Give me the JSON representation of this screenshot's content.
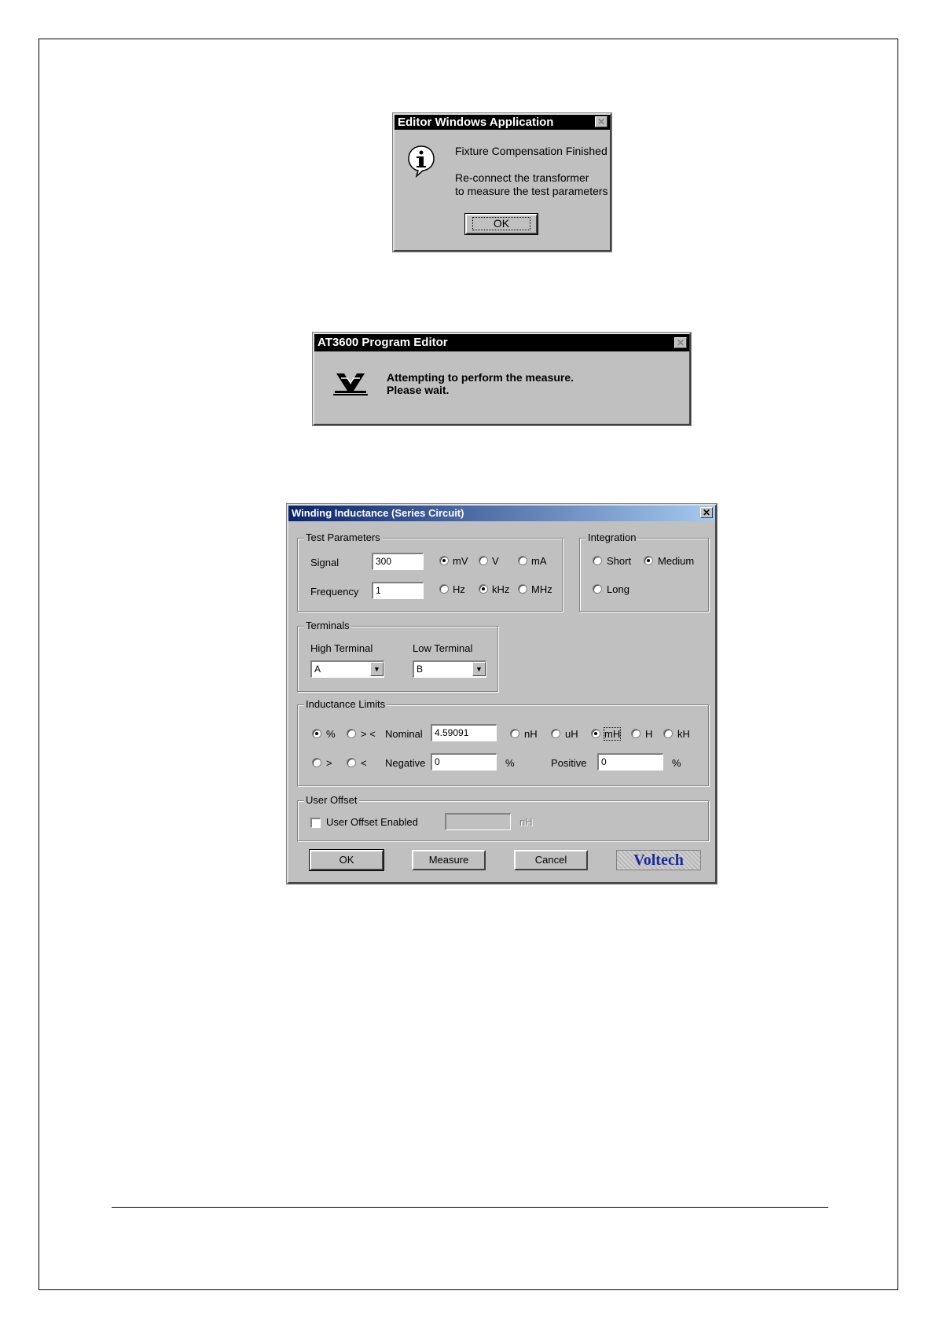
{
  "dialog1": {
    "title": "Editor Windows Application",
    "close_icon": "close-icon",
    "message_line1": "Fixture Compensation Finished",
    "message_line2": "Re-connect the transformer",
    "message_line3": "to measure the test parameters",
    "ok_label": "OK",
    "icon": "info-icon"
  },
  "dialog2": {
    "title": "AT3600 Program Editor",
    "message_line1": "Attempting to perform the measure.",
    "message_line2": "Please wait.",
    "icon": "voltech-v-icon"
  },
  "dialog3": {
    "title": "Winding Inductance (Series Circuit)",
    "test_parameters": {
      "label": "Test Parameters",
      "signal_label": "Signal",
      "signal_value": "300",
      "signal_units": [
        "mV",
        "V",
        "mA"
      ],
      "signal_selected": "mV",
      "frequency_label": "Frequency",
      "frequency_value": "1",
      "frequency_units": [
        "Hz",
        "kHz",
        "MHz"
      ],
      "frequency_selected": "kHz"
    },
    "integration": {
      "label": "Integration",
      "options": [
        "Short",
        "Medium",
        "Long"
      ],
      "selected": "Medium"
    },
    "terminals": {
      "label": "Terminals",
      "high_label": "High Terminal",
      "high_value": "A",
      "low_label": "Low Terminal",
      "low_value": "B"
    },
    "inductance_limits": {
      "label": "Inductance Limits",
      "mode_percent": "%",
      "mode_range": "> <",
      "mode_gt": ">",
      "mode_lt": "<",
      "mode_selected": "%",
      "nominal_label": "Nominal",
      "nominal_value": "4.59091",
      "units": [
        "nH",
        "uH",
        "mH",
        "H",
        "kH"
      ],
      "unit_selected": "mH",
      "negative_label": "Negative",
      "negative_value": "0",
      "negative_unit": "%",
      "positive_label": "Positive",
      "positive_value": "0",
      "positive_unit": "%"
    },
    "user_offset": {
      "label": "User Offset",
      "checkbox_label": "User Offset Enabled",
      "checked": false,
      "value": "",
      "unit": "nH"
    },
    "buttons": {
      "ok": "OK",
      "measure": "Measure",
      "cancel": "Cancel"
    },
    "logo_text": "Voltech"
  }
}
